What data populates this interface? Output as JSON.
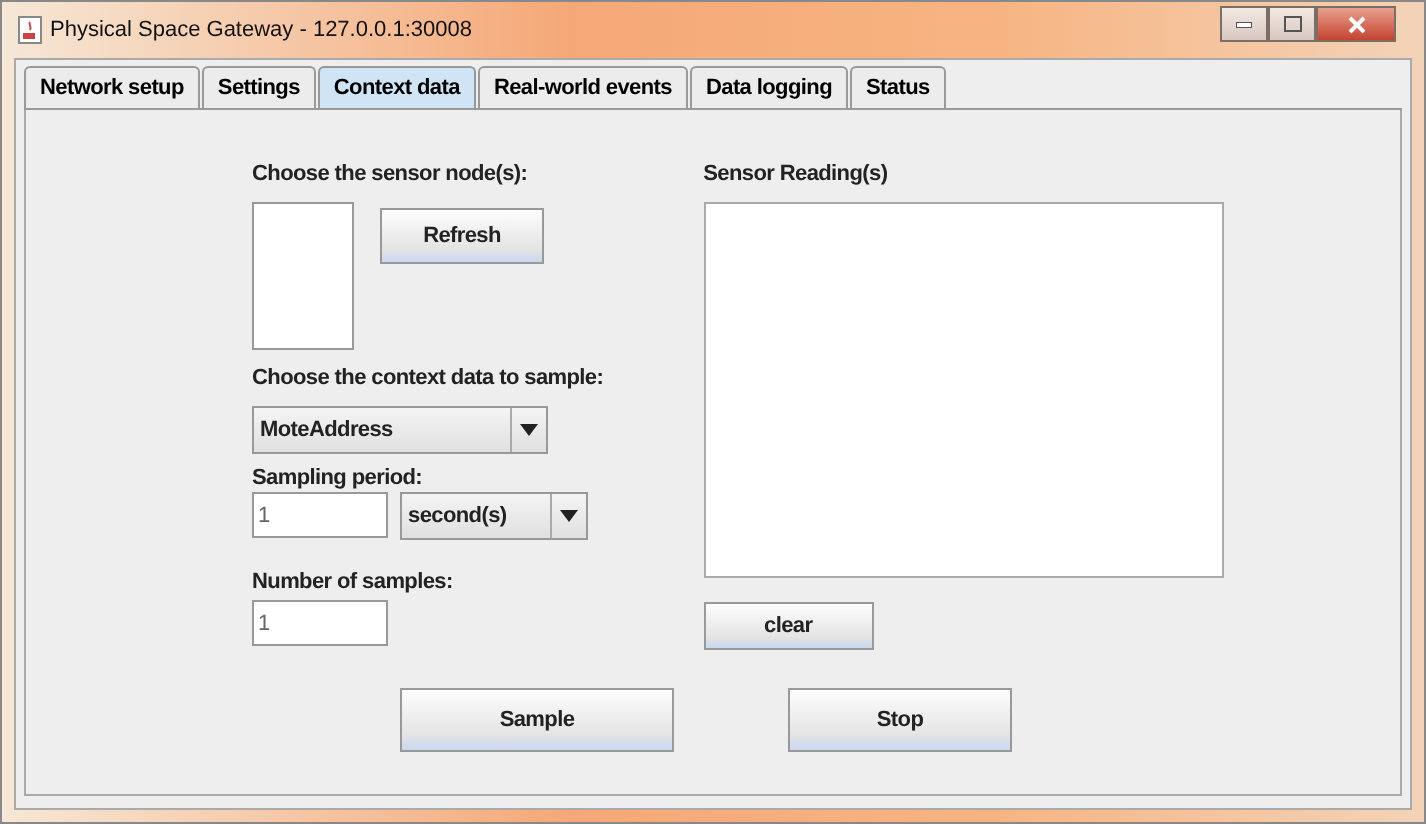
{
  "window": {
    "title": "Physical Space Gateway - 127.0.0.1:30008"
  },
  "tabs": [
    {
      "label": "Network setup",
      "selected": false
    },
    {
      "label": "Settings",
      "selected": false
    },
    {
      "label": "Context data",
      "selected": true
    },
    {
      "label": "Real-world events",
      "selected": false
    },
    {
      "label": "Data logging",
      "selected": false
    },
    {
      "label": "Status",
      "selected": false
    }
  ],
  "sensor_nodes": {
    "label": "Choose the sensor node(s):",
    "refresh_button": "Refresh"
  },
  "context_data": {
    "label": "Choose the context data to sample:",
    "value": "MoteAddress"
  },
  "sampling_period": {
    "label": "Sampling period:",
    "value": "1",
    "unit": "second(s)"
  },
  "number_of_samples": {
    "label": "Number of samples:",
    "value": "1"
  },
  "sensor_readings": {
    "label": "Sensor Reading(s)",
    "clear_button": "clear"
  },
  "buttons": [
    "Sample",
    "Stop"
  ]
}
